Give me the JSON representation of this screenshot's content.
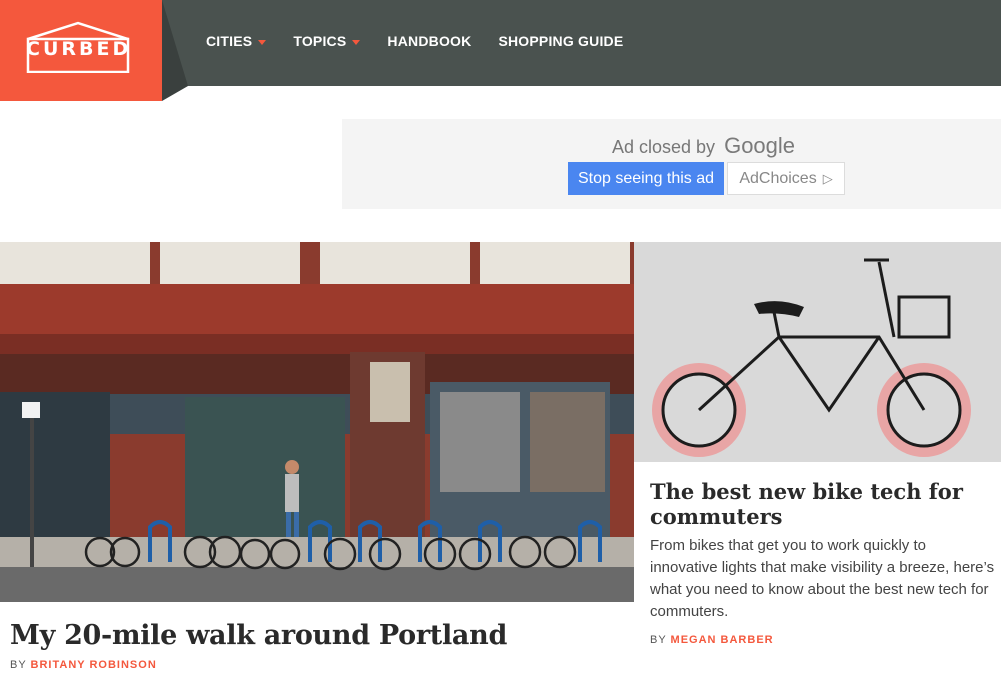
{
  "brand": {
    "logo_text": "CURBED",
    "accent": "#f4583d",
    "nav_bg": "#4a524f"
  },
  "nav": {
    "items": [
      {
        "label": "CITIES",
        "has_dropdown": true
      },
      {
        "label": "TOPICS",
        "has_dropdown": true
      },
      {
        "label": "HANDBOOK",
        "has_dropdown": false
      },
      {
        "label": "SHOPPING GUIDE",
        "has_dropdown": false
      }
    ]
  },
  "ad": {
    "closed_text": "Ad closed by",
    "google": "Google",
    "stop_label": "Stop seeing this ad",
    "adchoices_label": "AdChoices",
    "adchoices_icon": "adchoices-icon"
  },
  "articles": {
    "hero": {
      "title": "My 20-mile walk around Portland",
      "by": "BY",
      "author": "BRITANY ROBINSON"
    },
    "side": {
      "title": "The best new bike tech for commuters",
      "dek_lines": [
        "From bikes that get you to work quickly to",
        "innovative lights that make visibility a breeze, here’s",
        "what you need to know about the best new tech for",
        "commuters."
      ],
      "by": "BY",
      "author": "MEGAN BARBER"
    }
  }
}
